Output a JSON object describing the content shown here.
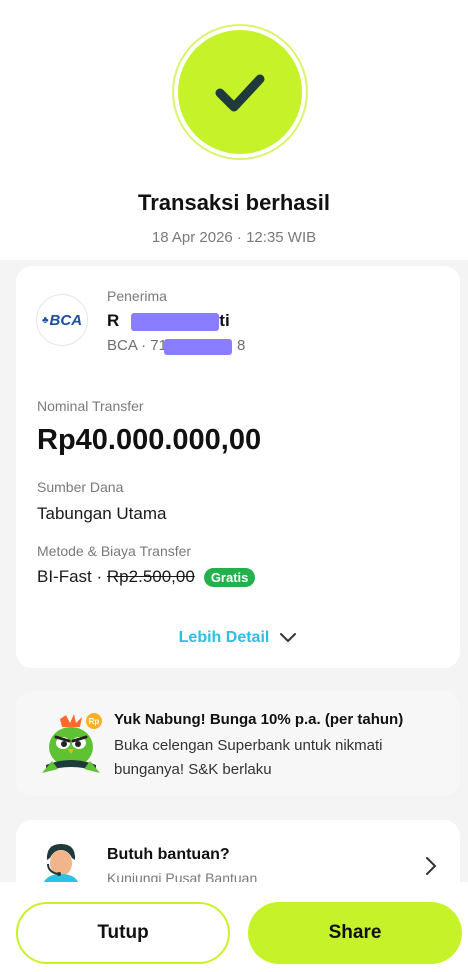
{
  "status": {
    "title": "Transaksi berhasil",
    "datetime": "18 Apr 2026 · 12:35 WIB",
    "icon": "check-icon"
  },
  "recipient": {
    "label": "Penerima",
    "name_prefix": "R",
    "name_suffix": "ti",
    "bank": "BCA",
    "account_prefix": "BCA · 71",
    "account_suffix": "8",
    "logo_text": "BCA"
  },
  "transfer": {
    "amount_label": "Nominal Transfer",
    "amount": "Rp40.000.000,00",
    "source_label": "Sumber Dana",
    "source": "Tabungan Utama",
    "method_label": "Metode & Biaya Transfer",
    "method": "BI-Fast · ",
    "fee_original": "Rp2.500,00",
    "fee_badge": "Gratis",
    "more_detail": "Lebih Detail"
  },
  "promo": {
    "title": "Yuk Nabung! Bunga 10% p.a. (per tahun)",
    "body": "Buka celengan Superbank untuk nikmati bunganya! S&K berlaku",
    "badge": "Rp"
  },
  "help": {
    "title": "Butuh bantuan?",
    "subtitle": "Kunjungi Pusat Bantuan"
  },
  "actions": {
    "close_label": "Tutup",
    "share_label": "Share"
  },
  "colors": {
    "accent": "#c6f22a",
    "link": "#2bc0e4",
    "success_badge": "#22b14c",
    "redaction": "#8a7dff"
  }
}
